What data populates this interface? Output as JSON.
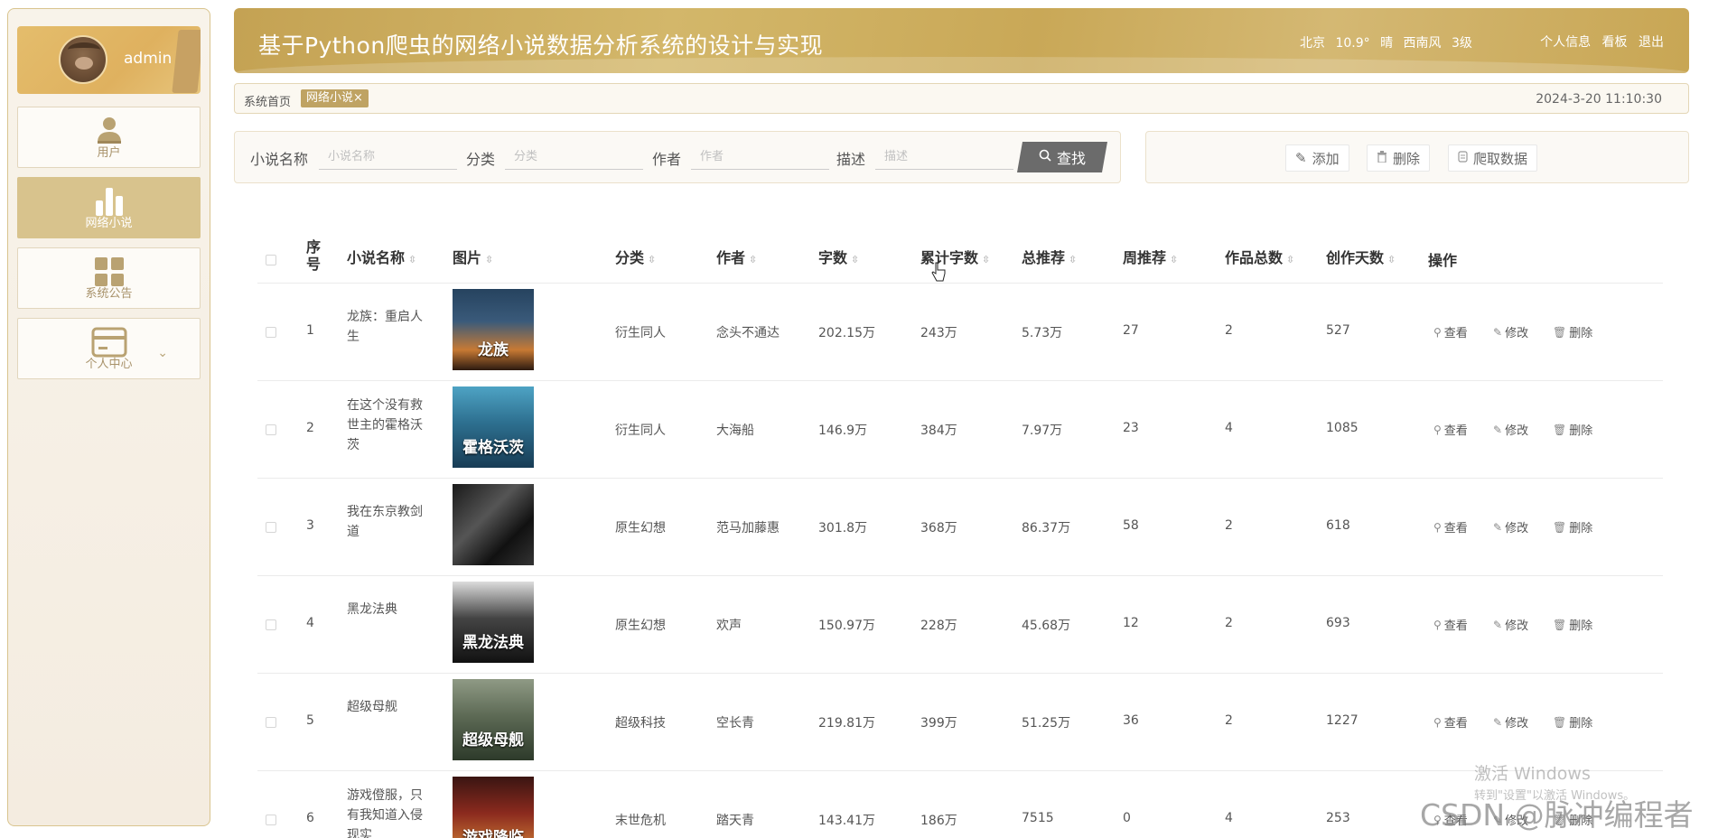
{
  "sidebar": {
    "user": "admin",
    "items": [
      {
        "label": "用户"
      },
      {
        "label": "网络小说"
      },
      {
        "label": "系统公告"
      },
      {
        "label": "个人中心"
      }
    ]
  },
  "header": {
    "title": "基于Python爬虫的网络小说数据分析系统的设计与实现",
    "weather": {
      "city": "北京",
      "temp": "10.9°",
      "cond": "晴",
      "wind": "西南风",
      "level": "3级"
    },
    "links": [
      "个人信息",
      "看板",
      "退出"
    ]
  },
  "tabs": {
    "home": "系统首页",
    "active": "网络小说×",
    "time": "2024-3-20 11:10:30"
  },
  "search": {
    "fields": [
      {
        "label": "小说名称",
        "placeholder": "小说名称"
      },
      {
        "label": "分类",
        "placeholder": "分类"
      },
      {
        "label": "作者",
        "placeholder": "作者"
      },
      {
        "label": "描述",
        "placeholder": "描述"
      }
    ],
    "button": "查找"
  },
  "actions": {
    "add": "添加",
    "delete": "删除",
    "crawl": "爬取数据"
  },
  "table": {
    "headers": [
      "序号",
      "小说名称",
      "图片",
      "分类",
      "作者",
      "字数",
      "累计字数",
      "总推荐",
      "周推荐",
      "作品总数",
      "创作天数",
      "操作"
    ],
    "rows": [
      {
        "no": "1",
        "name": "龙族：重启人生",
        "cover": "龙族",
        "category": "衍生同人",
        "author": "念头不通达",
        "words": "202.15万",
        "total_words": "243万",
        "total_rec": "5.73万",
        "week_rec": "27",
        "works": "2",
        "days": "527"
      },
      {
        "no": "2",
        "name": "在这个没有救世主的霍格沃茨",
        "cover": "霍格沃茨",
        "category": "衍生同人",
        "author": "大海船",
        "words": "146.9万",
        "total_words": "384万",
        "total_rec": "7.97万",
        "week_rec": "23",
        "works": "4",
        "days": "1085"
      },
      {
        "no": "3",
        "name": "我在东京教剑道",
        "cover": "",
        "category": "原生幻想",
        "author": "范马加藤惠",
        "words": "301.8万",
        "total_words": "368万",
        "total_rec": "86.37万",
        "week_rec": "58",
        "works": "2",
        "days": "618"
      },
      {
        "no": "4",
        "name": "黑龙法典",
        "cover": "黑龙法典",
        "category": "原生幻想",
        "author": "欢声",
        "words": "150.97万",
        "total_words": "228万",
        "total_rec": "45.68万",
        "week_rec": "12",
        "works": "2",
        "days": "693"
      },
      {
        "no": "5",
        "name": "超级母舰",
        "cover": "超级母舰",
        "category": "超级科技",
        "author": "空长青",
        "words": "219.81万",
        "total_words": "399万",
        "total_rec": "51.25万",
        "week_rec": "36",
        "works": "2",
        "days": "1227"
      },
      {
        "no": "6",
        "name": "游戏僜服，只有我知道入侵现实",
        "cover": "游戏降临",
        "category": "末世危机",
        "author": "踏天青",
        "words": "143.41万",
        "total_words": "186万",
        "total_rec": "7515",
        "week_rec": "0",
        "works": "4",
        "days": "253"
      }
    ],
    "ops": {
      "view": "查看",
      "edit": "修改",
      "delete": "删除"
    }
  },
  "watermark": {
    "line1": "激活 Windows",
    "line2": "转到\"设置\"以激活 Windows。",
    "csdn": "CSDN @脉冲编程者"
  },
  "colors": {
    "accent": "#c4a253",
    "active_nav": "#d8c38d",
    "search_button": "#6b6b6b"
  }
}
